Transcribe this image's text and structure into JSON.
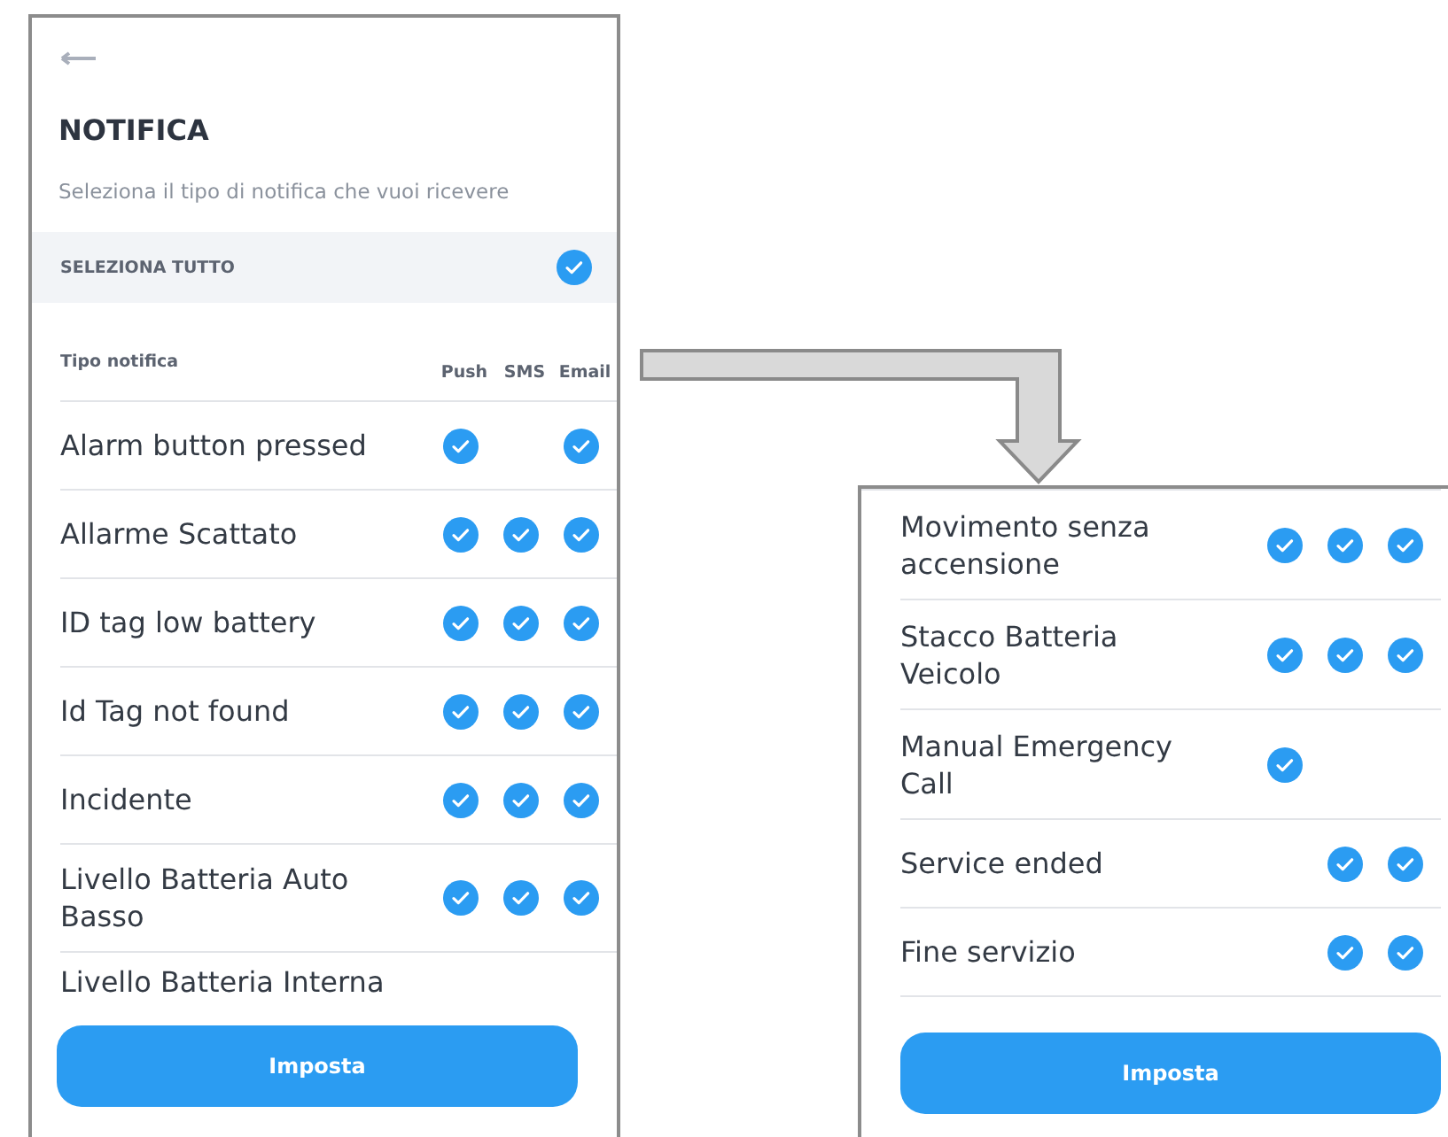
{
  "left_screen": {
    "title": "NOTIFICA",
    "subtitle": "Seleziona il tipo di notifica che vuoi ricevere",
    "select_all": {
      "label": "SELEZIONA TUTTO",
      "checked": true
    },
    "header": {
      "label": "Tipo notifica",
      "columns": [
        "Push",
        "SMS",
        "Email"
      ]
    },
    "rows": [
      {
        "label": "Alarm button pressed",
        "push": true,
        "sms": false,
        "email": true
      },
      {
        "label": "Allarme Scattato",
        "push": true,
        "sms": true,
        "email": true
      },
      {
        "label": "ID tag low battery",
        "push": true,
        "sms": true,
        "email": true
      },
      {
        "label": "Id Tag not found",
        "push": true,
        "sms": true,
        "email": true
      },
      {
        "label": "Incidente",
        "push": true,
        "sms": true,
        "email": true
      },
      {
        "label": "Livello Batteria Auto Basso",
        "push": true,
        "sms": true,
        "email": true
      }
    ],
    "cut_row": {
      "label": "Livello Batteria Interna"
    },
    "button": "Imposta"
  },
  "right_screen": {
    "rows": [
      {
        "label": "Movimento senza accensione",
        "push": true,
        "sms": true,
        "email": true
      },
      {
        "label": "Stacco Batteria Veicolo",
        "push": true,
        "sms": true,
        "email": true
      },
      {
        "label": "Manual Emergency Call",
        "push": true,
        "sms": false,
        "email": false
      },
      {
        "label": "Service ended",
        "push": false,
        "sms": true,
        "email": true
      },
      {
        "label": "Fine servizio",
        "push": false,
        "sms": true,
        "email": true
      }
    ],
    "button": "Imposta"
  }
}
